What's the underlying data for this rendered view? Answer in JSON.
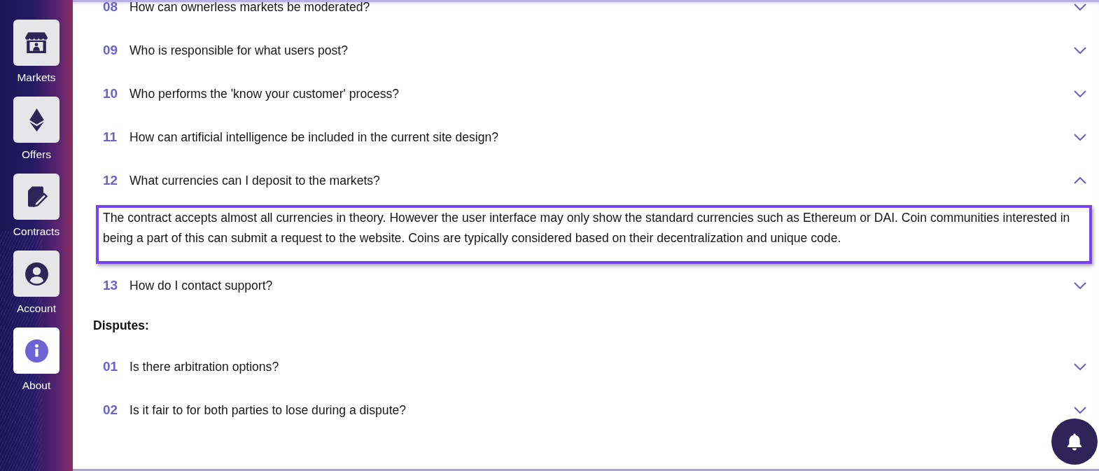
{
  "sidebar": {
    "items": [
      {
        "label": "Markets",
        "selected": false
      },
      {
        "label": "Offers",
        "selected": false
      },
      {
        "label": "Contracts",
        "selected": false
      },
      {
        "label": "Account",
        "selected": false
      },
      {
        "label": "About",
        "selected": true
      }
    ]
  },
  "faq_sections": [
    {
      "items": [
        {
          "number": "08",
          "question": "How can ownerless markets be moderated?",
          "expanded": false
        },
        {
          "number": "09",
          "question": "Who is responsible for what users post?",
          "expanded": false
        },
        {
          "number": "10",
          "question": "Who performs the 'know your customer' process?",
          "expanded": false
        },
        {
          "number": "11",
          "question": "How can artificial intelligence be included in the current site design?",
          "expanded": false
        },
        {
          "number": "12",
          "question": "What currencies can I deposit to the markets?",
          "expanded": true,
          "answer": "The contract accepts almost all currencies in theory. However the user interface may only show the standard currencies such as Ethereum or DAI. Coin communities interested in being a part of this can submit a request to the website. Coins are typically considered based on their decentralization and unique code."
        },
        {
          "number": "13",
          "question": "How do I contact support?",
          "expanded": false
        }
      ]
    },
    {
      "heading": "Disputes:",
      "items": [
        {
          "number": "01",
          "question": "Is there arbitration options?",
          "expanded": false
        },
        {
          "number": "02",
          "question": "Is it fair to for both parties to lose during a dispute?",
          "expanded": false
        }
      ]
    }
  ]
}
